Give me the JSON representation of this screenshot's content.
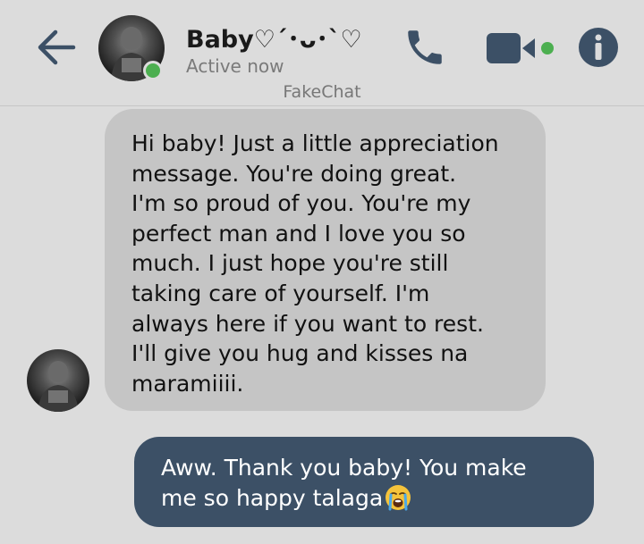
{
  "header": {
    "contact_name": "Baby♡´･ᴗ･`♡",
    "status": "Active now",
    "watermark": "FakeChat",
    "icons": [
      "back-arrow-icon",
      "phone-icon",
      "video-camera-icon",
      "info-icon"
    ],
    "online_indicator_color": "#4caf50"
  },
  "messages": [
    {
      "direction": "incoming",
      "text": "Hi baby! Just a little appreciation\nmessage. You're doing great.\nI'm so proud of you. You're my\nperfect man and I love you so\nmuch. I just hope you're still\ntaking care of yourself. I'm\nalways here if you want to rest.\nI'll give you hug and kisses na\nmaramiiii."
    },
    {
      "direction": "outgoing",
      "text": "Aww. Thank you baby! You make\nme so happy talaga",
      "emoji": "loudly-crying-face-emoji"
    }
  ],
  "colors": {
    "background": "#dcdcdc",
    "incoming_bubble": "#c5c5c5",
    "outgoing_bubble": "#3c5066",
    "icon_color": "#3c5066",
    "accent_green": "#4caf50"
  }
}
